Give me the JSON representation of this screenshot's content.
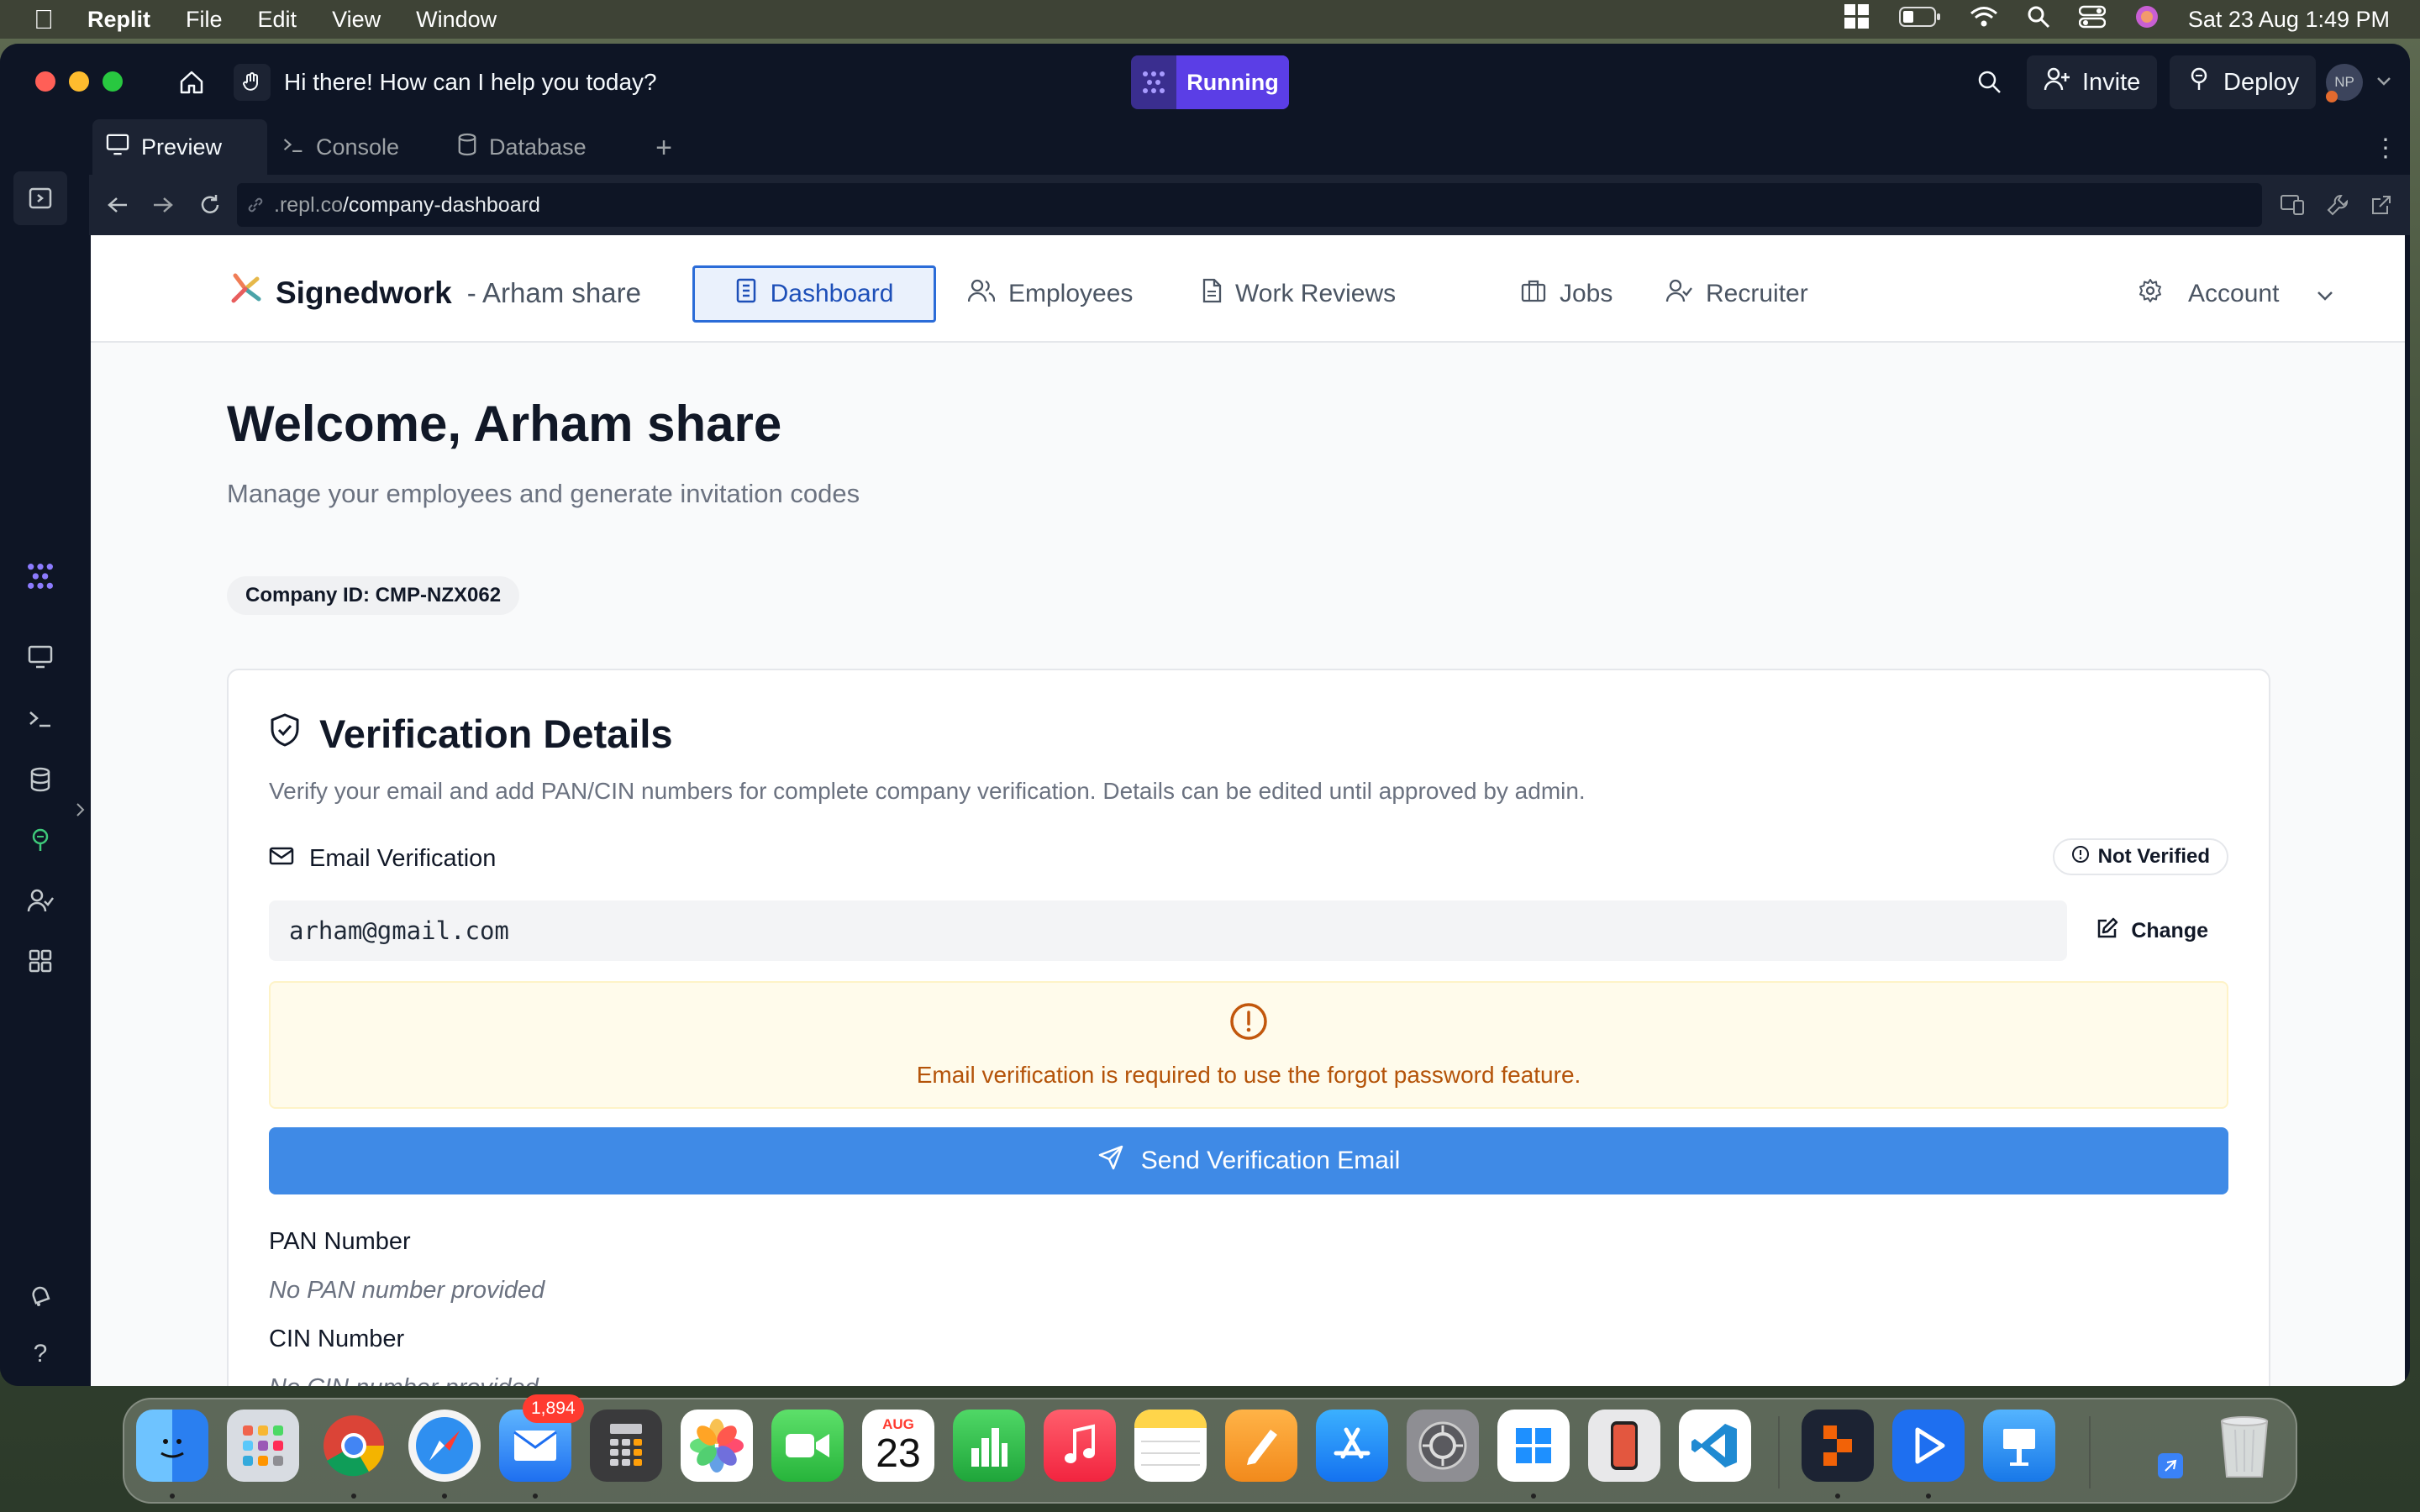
{
  "menubar": {
    "app_name": "Replit",
    "menus": [
      "File",
      "Edit",
      "View",
      "Window"
    ],
    "clock": "Sat 23 Aug  1:49 PM"
  },
  "window": {
    "ask_prompt": "Hi there! How can I help you today?",
    "run_status": "Running",
    "invite_label": "Invite",
    "deploy_label": "Deploy",
    "avatar_initials": "NP",
    "tabs": [
      {
        "label": "Preview",
        "icon": "monitor-icon"
      },
      {
        "label": "Console",
        "icon": "terminal-icon"
      },
      {
        "label": "Database",
        "icon": "database-icon"
      }
    ],
    "url_host": ".repl.co",
    "url_path": "/company-dashboard"
  },
  "app": {
    "brand": "Signedwork",
    "company_suffix": "- Arham share",
    "nav": [
      {
        "label": "Dashboard",
        "icon": "dashboard-icon",
        "active": true
      },
      {
        "label": "Employees",
        "icon": "users-icon",
        "active": false
      },
      {
        "label": "Work Reviews",
        "icon": "document-icon",
        "active": false
      },
      {
        "label": "Jobs",
        "icon": "briefcase-icon",
        "active": false
      },
      {
        "label": "Recruiter",
        "icon": "user-check-icon",
        "active": false
      }
    ],
    "account_label": "Account",
    "welcome": "Welcome, Arham share",
    "subtitle": "Manage your employees and generate invitation codes",
    "company_id": "Company ID: CMP-NZX062",
    "verification": {
      "title": "Verification Details",
      "description": "Verify your email and add PAN/CIN numbers for complete company verification. Details can be edited until approved by admin.",
      "email_label": "Email Verification",
      "status": "Not Verified",
      "email_value": "arham@gmail.com",
      "change_label": "Change",
      "warning": "Email verification is required to use the forgot password feature.",
      "send_label": "Send Verification Email",
      "pan_label": "PAN Number",
      "pan_value": "No PAN number provided",
      "cin_label": "CIN Number",
      "cin_value": "No CIN number provided"
    }
  },
  "dock": {
    "mail_badge": "1,894",
    "calendar_month": "AUG",
    "calendar_day": "23"
  },
  "colors": {
    "primary": "#3f8ae6",
    "nav_active_border": "#2b6cd8",
    "warning_text": "#b45309",
    "running_purple": "#5b3ee6"
  }
}
